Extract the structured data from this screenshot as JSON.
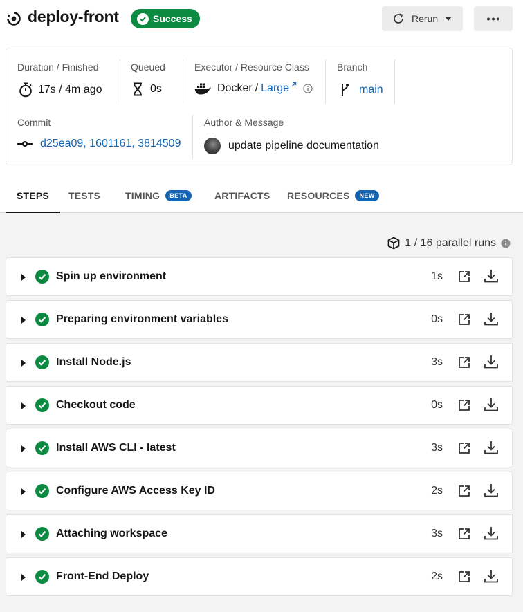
{
  "header": {
    "job_name": "deploy-front",
    "status": "Success",
    "rerun_label": "Rerun",
    "more_label": "•••"
  },
  "info": {
    "duration": {
      "label": "Duration / Finished",
      "value": "17s / 4m ago"
    },
    "queued": {
      "label": "Queued",
      "value": "0s"
    },
    "executor": {
      "label": "Executor / Resource Class",
      "name": "Docker",
      "separator": "/",
      "resource_class": "Large"
    },
    "branch": {
      "label": "Branch",
      "value": "main"
    },
    "commit": {
      "label": "Commit",
      "value": "d25ea09, 1601161, 3814509"
    },
    "author": {
      "label": "Author & Message",
      "message": "update pipeline documentation"
    }
  },
  "tabs": [
    {
      "label": "STEPS",
      "active": true
    },
    {
      "label": "TESTS"
    },
    {
      "label": "TIMING",
      "badge": "BETA"
    },
    {
      "label": "ARTIFACTS"
    },
    {
      "label": "RESOURCES",
      "badge": "NEW"
    }
  ],
  "parallel_runs": "1 / 16 parallel runs",
  "steps": [
    {
      "name": "Spin up environment",
      "duration": "1s",
      "status": "success"
    },
    {
      "name": "Preparing environment variables",
      "duration": "0s",
      "status": "success"
    },
    {
      "name": "Install Node.js",
      "duration": "3s",
      "status": "success"
    },
    {
      "name": "Checkout code",
      "duration": "0s",
      "status": "success"
    },
    {
      "name": "Install AWS CLI - latest",
      "duration": "3s",
      "status": "success"
    },
    {
      "name": "Configure AWS Access Key ID",
      "duration": "2s",
      "status": "success"
    },
    {
      "name": "Attaching workspace",
      "duration": "3s",
      "status": "success"
    },
    {
      "name": "Front-End Deploy",
      "duration": "2s",
      "status": "success"
    }
  ],
  "colors": {
    "success": "#0c8a41",
    "link": "#1364b2",
    "badge": "#1364b2"
  }
}
